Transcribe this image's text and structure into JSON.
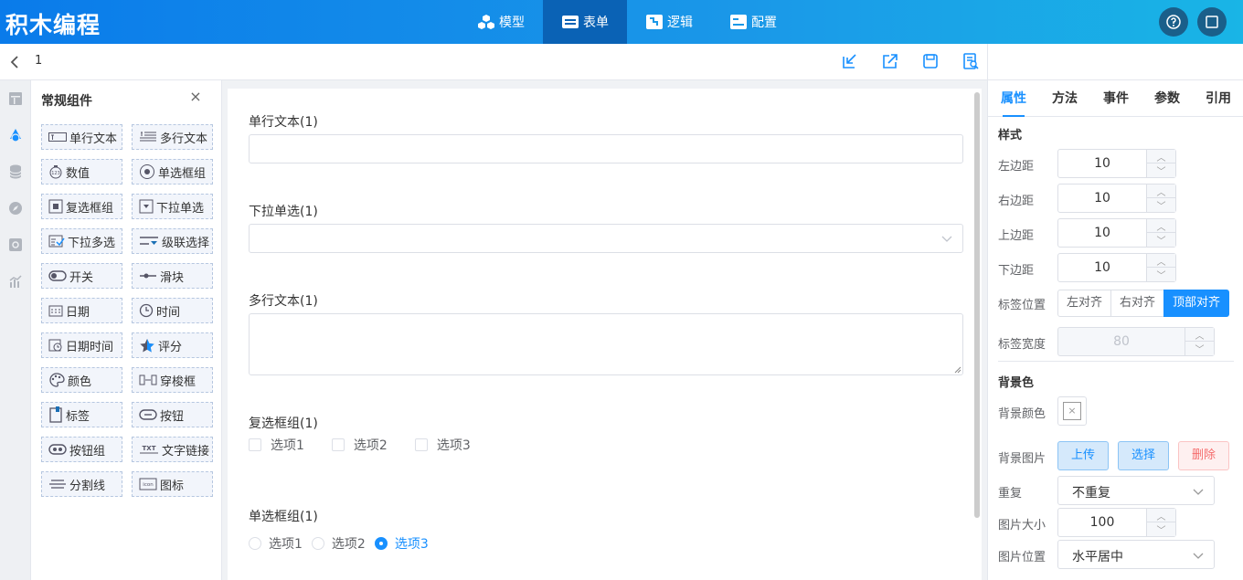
{
  "header": {
    "logo": "积木编程",
    "tabs": [
      {
        "label": "模型"
      },
      {
        "label": "表单"
      },
      {
        "label": "逻辑"
      },
      {
        "label": "配置"
      }
    ],
    "active_tab": "表单",
    "help_icon": "help-icon",
    "window_icon": "square-icon"
  },
  "toolbar": {
    "page_name": "1",
    "icons": [
      "import-icon",
      "export-icon",
      "save-icon",
      "preview-icon"
    ]
  },
  "palette": {
    "title": "常规组件",
    "items": [
      {
        "label": "单行文本",
        "icon": "single-line-text-icon"
      },
      {
        "label": "多行文本",
        "icon": "multi-line-text-icon"
      },
      {
        "label": "数值",
        "icon": "number-icon"
      },
      {
        "label": "单选框组",
        "icon": "radio-group-icon"
      },
      {
        "label": "复选框组",
        "icon": "checkbox-group-icon"
      },
      {
        "label": "下拉单选",
        "icon": "dropdown-single-icon"
      },
      {
        "label": "下拉多选",
        "icon": "dropdown-multi-icon"
      },
      {
        "label": "级联选择",
        "icon": "cascader-icon"
      },
      {
        "label": "开关",
        "icon": "switch-icon"
      },
      {
        "label": "滑块",
        "icon": "slider-icon"
      },
      {
        "label": "日期",
        "icon": "date-icon"
      },
      {
        "label": "时间",
        "icon": "time-icon"
      },
      {
        "label": "日期时间",
        "icon": "datetime-icon"
      },
      {
        "label": "评分",
        "icon": "rate-icon"
      },
      {
        "label": "颜色",
        "icon": "color-icon"
      },
      {
        "label": "穿梭框",
        "icon": "transfer-icon"
      },
      {
        "label": "标签",
        "icon": "label-icon"
      },
      {
        "label": "按钮",
        "icon": "button-icon"
      },
      {
        "label": "按钮组",
        "icon": "button-group-icon"
      },
      {
        "label": "文字链接",
        "icon": "text-link-icon"
      },
      {
        "label": "分割线",
        "icon": "divider-icon"
      },
      {
        "label": "图标",
        "icon": "icon-icon"
      }
    ]
  },
  "canvas": {
    "fields": {
      "single_text": {
        "label": "单行文本(1)"
      },
      "dropdown": {
        "label": "下拉单选(1)"
      },
      "multi_text": {
        "label": "多行文本(1)"
      },
      "checkbox": {
        "label": "复选框组(1)",
        "options": [
          "选项1",
          "选项2",
          "选项3"
        ]
      },
      "radio": {
        "label": "单选框组(1)",
        "options": [
          "选项1",
          "选项2",
          "选项3"
        ],
        "selected": "选项3"
      }
    }
  },
  "props": {
    "tabs": [
      "属性",
      "方法",
      "事件",
      "参数",
      "引用"
    ],
    "active_tab": "属性",
    "style_title": "样式",
    "margin_left": {
      "label": "左边距",
      "value": "10"
    },
    "margin_right": {
      "label": "右边距",
      "value": "10"
    },
    "margin_top": {
      "label": "上边距",
      "value": "10"
    },
    "margin_bottom": {
      "label": "下边距",
      "value": "10"
    },
    "label_position": {
      "label": "标签位置",
      "options": [
        "左对齐",
        "右对齐",
        "顶部对齐"
      ],
      "selected": "顶部对齐"
    },
    "label_width": {
      "label": "标签宽度",
      "value": "80",
      "disabled": true
    },
    "bg_title": "背景色",
    "bg_color": {
      "label": "背景颜色",
      "clear_symbol": "×"
    },
    "bg_image": {
      "label": "背景图片",
      "upload": "上传",
      "select": "选择",
      "delete": "删除"
    },
    "repeat": {
      "label": "重复",
      "value": "不重复"
    },
    "image_size": {
      "label": "图片大小",
      "value": "100"
    },
    "image_position": {
      "label": "图片位置",
      "value": "水平居中"
    }
  },
  "colors": {
    "accent": "#1890ff",
    "header_start": "#0a7bea",
    "header_end": "#19b5e6",
    "active_tab_bg": "#0a62b5",
    "danger": "#f56c6c"
  }
}
